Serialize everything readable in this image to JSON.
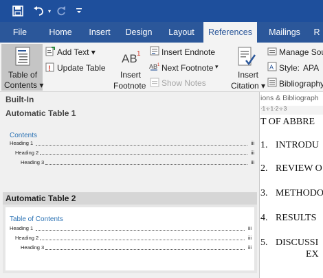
{
  "title_bar": {
    "accent": "#1e4f9c",
    "qat": [
      "save-icon",
      "undo-icon",
      "redo-icon",
      "customize-icon"
    ]
  },
  "tabs": [
    "File",
    "Home",
    "Insert",
    "Design",
    "Layout",
    "References",
    "Mailings",
    "R"
  ],
  "active_tab": "References",
  "ribbon": {
    "toc_button": {
      "line1": "Table of",
      "line2": "Contents ▾"
    },
    "add_text": "Add Text ▾",
    "update_table": "Update Table",
    "insert_footnote": {
      "line1": "Insert",
      "line2": "Footnote"
    },
    "insert_endnote": "Insert Endnote",
    "next_footnote": "Next Footnote",
    "next_footnote_caret": "▾",
    "show_notes": "Show Notes",
    "insert_citation": {
      "line1": "Insert",
      "line2": "Citation ▾"
    },
    "manage_sources": "Manage Sou",
    "style_label": "Style:",
    "style_value": "APA",
    "bibliography": "Bibliography"
  },
  "gallery": {
    "header": "Built-In",
    "auto1": {
      "name": "Automatic Table 1",
      "title": "Contents",
      "entries": [
        {
          "label": "Heading 1",
          "page": "iii"
        },
        {
          "label": "Heading 2",
          "page": "iii"
        },
        {
          "label": "Heading 3",
          "page": "iii"
        }
      ]
    },
    "auto2": {
      "name": "Automatic Table 2",
      "title": "Table of Contents",
      "entries": [
        {
          "label": "Heading 1",
          "page": "iii"
        },
        {
          "label": "Heading 2",
          "page": "iii"
        },
        {
          "label": "Heading 3",
          "page": "iii"
        }
      ]
    }
  },
  "document": {
    "pane_label": "ions & Bibliograph",
    "ruler": "·1·ı·1·2·ı·3",
    "lines": [
      {
        "num": "",
        "text": "T OF ABBRE"
      },
      {
        "num": "1.",
        "text": "INTRODU"
      },
      {
        "num": "2.",
        "text": "REVIEW O"
      },
      {
        "num": "3.",
        "text": "METHODO"
      },
      {
        "num": "4.",
        "text": "RESULTS"
      },
      {
        "num": "5.",
        "text": "DISCUSSI"
      },
      {
        "num": "",
        "text": "EX"
      }
    ]
  }
}
